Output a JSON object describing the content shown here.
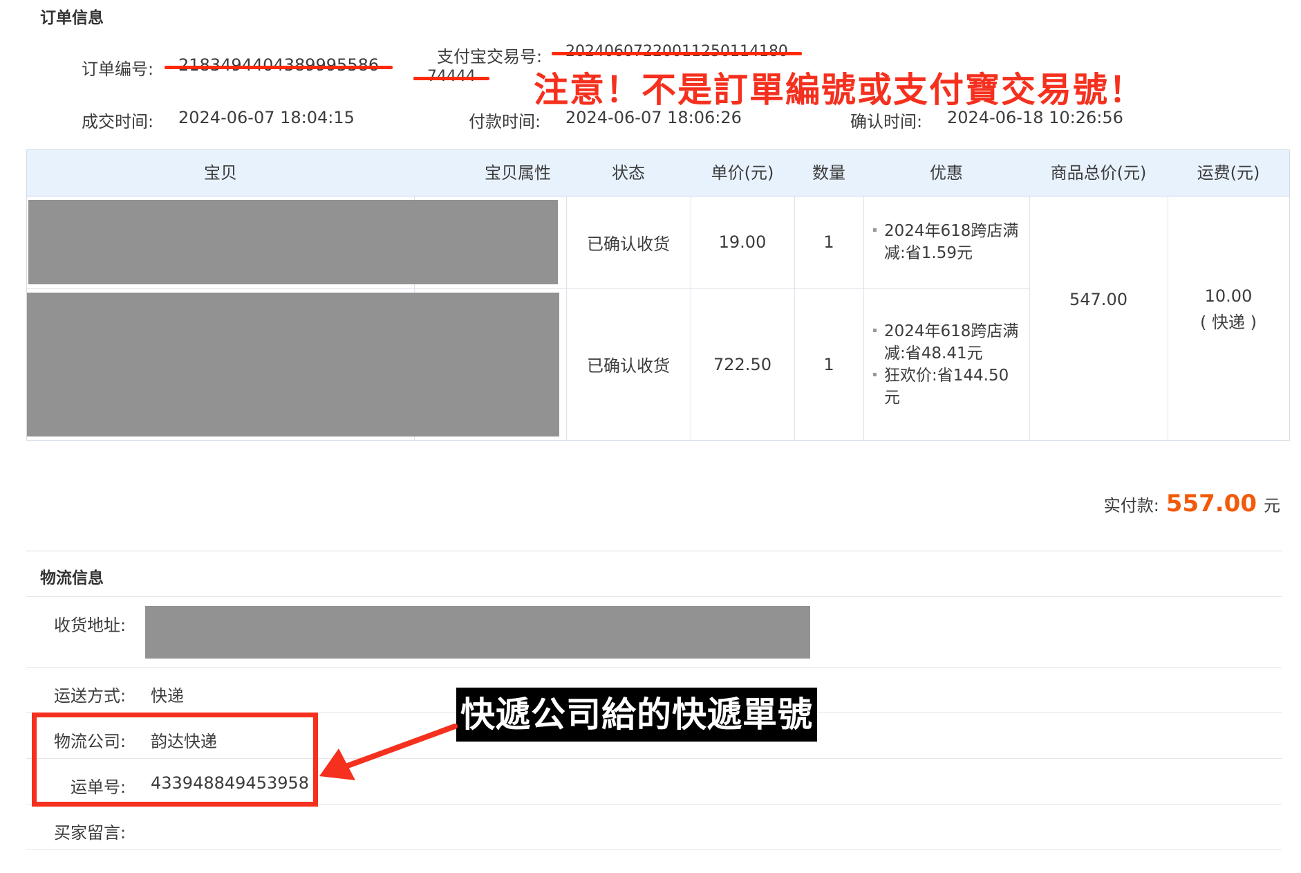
{
  "order": {
    "section_title": "订单信息",
    "order_no_label": "订单编号:",
    "order_no": "2183494404389995586",
    "alipay_label": "支付宝交易号:",
    "alipay_no_line1": "20240607220011250114180",
    "alipay_no_line2": "74444",
    "deal_time_label": "成交时间:",
    "deal_time": "2024-06-07 18:04:15",
    "pay_time_label": "付款时间:",
    "pay_time": "2024-06-07 18:06:26",
    "confirm_time_label": "确认时间:",
    "confirm_time": "2024-06-18 10:26:56"
  },
  "annotations": {
    "warning": "注意！不是訂單編號或支付寶交易號！",
    "tracking_callout": "快遞公司給的快遞單號",
    "accent_color": "#f5301e"
  },
  "table": {
    "headers": [
      "宝贝",
      "宝贝属性",
      "状态",
      "单价(元)",
      "数量",
      "优惠",
      "商品总价(元)",
      "运费(元)"
    ],
    "rows": [
      {
        "status": "已确认收货",
        "price": "19.00",
        "qty": "1",
        "discounts": [
          "2024年618跨店满减:省1.59元"
        ]
      },
      {
        "status": "已确认收货",
        "price": "722.50",
        "qty": "1",
        "discounts": [
          "2024年618跨店满减:省48.41元",
          "狂欢价:省144.50元"
        ]
      }
    ],
    "total": "547.00",
    "shipping_fee": "10.00",
    "shipping_note": "( 快递 )"
  },
  "payment": {
    "label": "实付款:",
    "amount": "557.00",
    "unit": "元",
    "amount_color": "#f25a0a"
  },
  "logistics": {
    "section_title": "物流信息",
    "address_label": "收货地址:",
    "method_label": "运送方式:",
    "method": "快递",
    "company_label": "物流公司:",
    "company": "韵达快递",
    "tracking_label": "运单号:",
    "tracking_no": "433948849453958",
    "message_label": "买家留言:",
    "message": ""
  }
}
